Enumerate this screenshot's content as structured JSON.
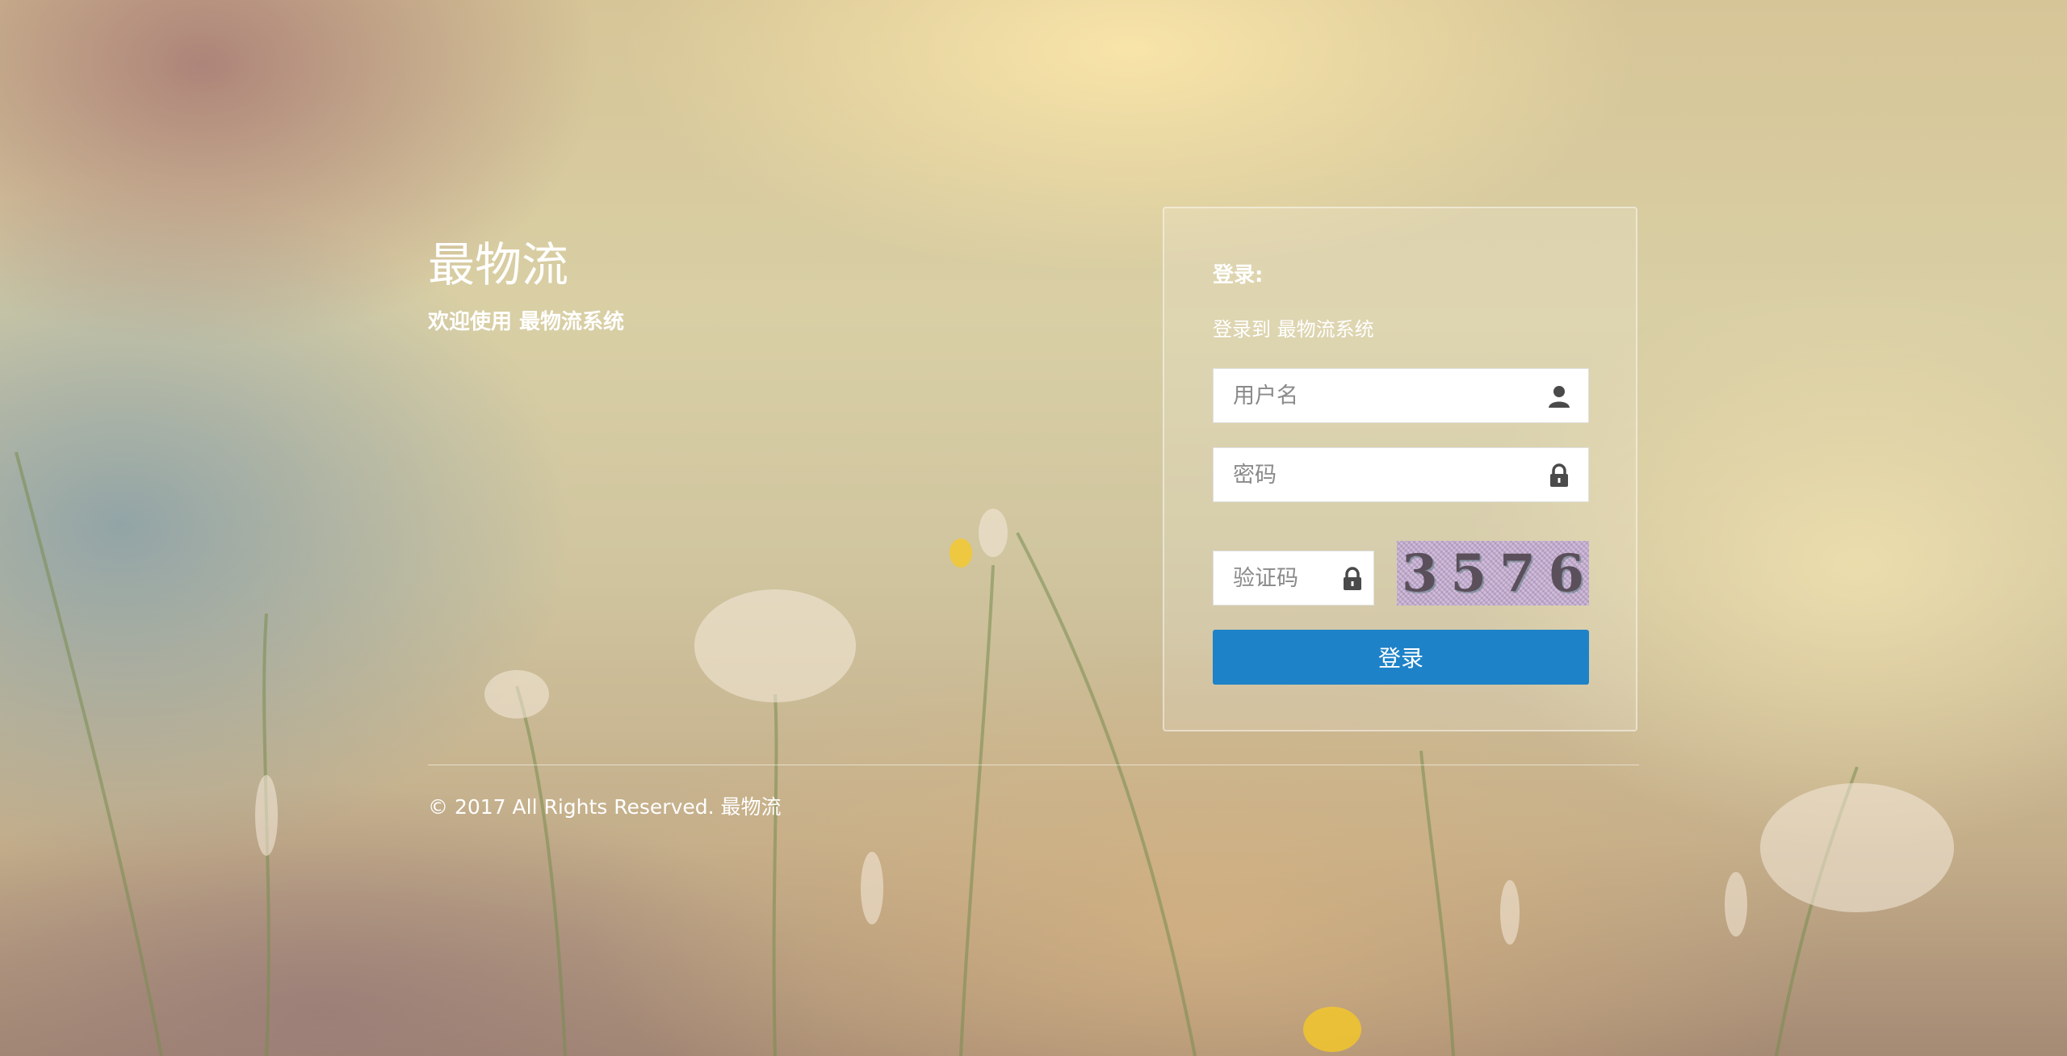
{
  "brand": {
    "title": "最物流",
    "subtitle": "欢迎使用 最物流系统"
  },
  "login_panel": {
    "heading": "登录:",
    "description": "登录到 最物流系统",
    "username_placeholder": "用户名",
    "password_placeholder": "密码",
    "captcha_placeholder": "验证码",
    "captcha_text": "3576",
    "submit_label": "登录"
  },
  "footer": {
    "copyright": "© 2017 All Rights Reserved. 最物流"
  },
  "icons": {
    "username": "user-icon",
    "password": "lock-icon",
    "captcha": "lock-icon"
  },
  "colors": {
    "primary_button": "#1e82c8",
    "text": "#ffffff"
  }
}
